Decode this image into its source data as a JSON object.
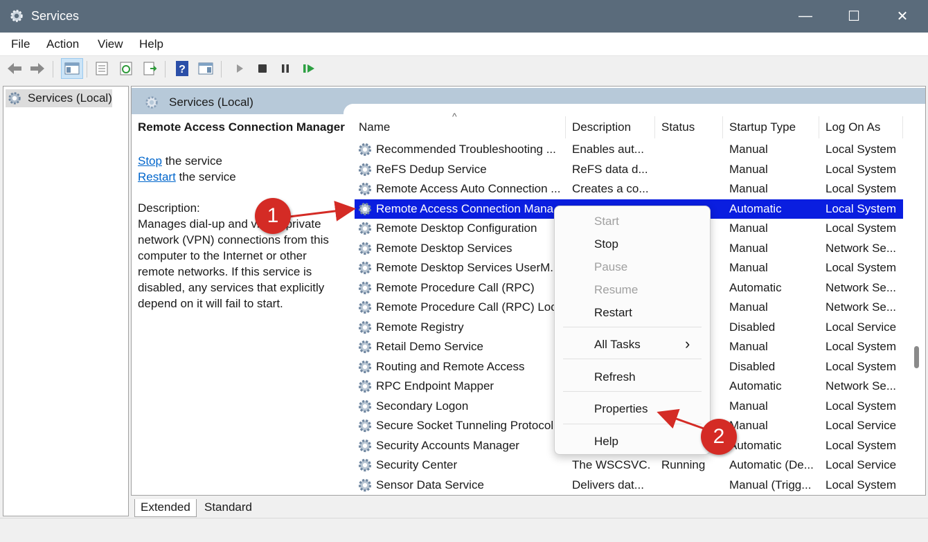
{
  "window": {
    "title": "Services",
    "controls": {
      "minimize": "—",
      "maximize": "☐",
      "close": "✕"
    }
  },
  "menu": [
    "File",
    "Action",
    "View",
    "Help"
  ],
  "toolbar_icons": [
    "back-arrow-icon",
    "forward-arrow-icon",
    "show-hide-tree-icon",
    "properties-icon",
    "refresh-icon",
    "export-list-icon",
    "help-icon",
    "console-view-icon",
    "start-service-icon",
    "stop-service-icon",
    "pause-service-icon",
    "restart-service-icon"
  ],
  "tree": {
    "root_label": "Services (Local)"
  },
  "panel": {
    "header_title": "Services (Local)"
  },
  "detail": {
    "service_title": "Remote Access Connection Manager",
    "stop_link": "Stop",
    "stop_rest": " the service",
    "restart_link": "Restart",
    "restart_rest": " the service",
    "description_label": "Description:",
    "description_text": "Manages dial-up and virtual private network (VPN) connections from this computer to the Internet or other remote networks. If this service is disabled, any services that explicitly depend on it will fail to start."
  },
  "columns": {
    "name": "Name",
    "description": "Description",
    "status": "Status",
    "startup": "Startup Type",
    "logon": "Log On As",
    "sort_indicator": "^"
  },
  "rows": [
    {
      "name": "Recommended Troubleshooting ...",
      "description": "Enables aut...",
      "status": "",
      "startup": "Manual",
      "logon": "Local System"
    },
    {
      "name": "ReFS Dedup Service",
      "description": "ReFS data d...",
      "status": "",
      "startup": "Manual",
      "logon": "Local System"
    },
    {
      "name": "Remote Access Auto Connection ...",
      "description": "Creates a co...",
      "status": "",
      "startup": "Manual",
      "logon": "Local System"
    },
    {
      "name": "Remote Access Connection Mana",
      "description": "",
      "status": "",
      "startup": "Automatic",
      "logon": "Local System",
      "selected": true
    },
    {
      "name": "Remote Desktop Configuration",
      "description": "",
      "status": "",
      "startup": "Manual",
      "logon": "Local System"
    },
    {
      "name": "Remote Desktop Services",
      "description": "",
      "status": "",
      "startup": "Manual",
      "logon": "Network Se..."
    },
    {
      "name": "Remote Desktop Services UserM...",
      "description": "",
      "status": "",
      "startup": "Manual",
      "logon": "Local System"
    },
    {
      "name": "Remote Procedure Call (RPC)",
      "description": "",
      "status": "",
      "startup": "Automatic",
      "logon": "Network Se..."
    },
    {
      "name": "Remote Procedure Call (RPC) Loca",
      "description": "",
      "status": "",
      "startup": "Manual",
      "logon": "Network Se..."
    },
    {
      "name": "Remote Registry",
      "description": "",
      "status": "",
      "startup": "Disabled",
      "logon": "Local Service"
    },
    {
      "name": "Retail Demo Service",
      "description": "",
      "status": "",
      "startup": "Manual",
      "logon": "Local System"
    },
    {
      "name": "Routing and Remote Access",
      "description": "",
      "status": "",
      "startup": "Disabled",
      "logon": "Local System"
    },
    {
      "name": "RPC Endpoint Mapper",
      "description": "",
      "status": "",
      "startup": "Automatic",
      "logon": "Network Se..."
    },
    {
      "name": "Secondary Logon",
      "description": "",
      "status": "",
      "startup": "Manual",
      "logon": "Local System"
    },
    {
      "name": "Secure Socket Tunneling Protocol",
      "description": "",
      "status": "",
      "startup": "Manual",
      "logon": "Local Service"
    },
    {
      "name": "Security Accounts Manager",
      "description": "",
      "status": "",
      "startup": "Automatic",
      "logon": "Local System"
    },
    {
      "name": "Security Center",
      "description": "The WSCSVC...",
      "status": "Running",
      "startup": "Automatic (De...",
      "logon": "Local Service"
    },
    {
      "name": "Sensor Data Service",
      "description": "Delivers dat...",
      "status": "",
      "startup": "Manual (Trigg...",
      "logon": "Local System"
    }
  ],
  "context_menu": {
    "start": "Start",
    "stop": "Stop",
    "pause": "Pause",
    "resume": "Resume",
    "restart": "Restart",
    "all_tasks": "All Tasks",
    "all_tasks_arrow": "›",
    "refresh": "Refresh",
    "properties": "Properties",
    "help": "Help"
  },
  "tabs": {
    "extended": "Extended",
    "standard": "Standard"
  },
  "annotations": {
    "step1": "1",
    "step2": "2",
    "color": "#d42b25"
  }
}
